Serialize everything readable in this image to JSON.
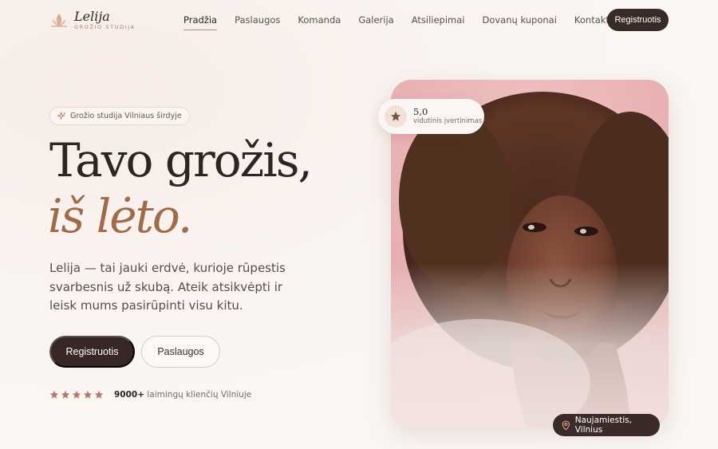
{
  "brand": {
    "name": "Lelija",
    "tagline": "GROŽIO STUDIJA"
  },
  "nav": {
    "items": [
      {
        "label": "Pradžia",
        "active": true
      },
      {
        "label": "Paslaugos",
        "active": false
      },
      {
        "label": "Komanda",
        "active": false
      },
      {
        "label": "Galerija",
        "active": false
      },
      {
        "label": "Atsiliepimai",
        "active": false
      },
      {
        "label": "Dovanų kuponai",
        "active": false
      },
      {
        "label": "Kontaktai",
        "active": false
      }
    ],
    "cta": "Registruotis"
  },
  "hero": {
    "badge": "Grožio studija Vilniaus širdyje",
    "headline_line1": "Tavo grožis,",
    "headline_line2": "iš lėto.",
    "lead": "Lelija — tai jauki erdvė, kurioje rūpestis svarbesnis už skubą. Ateik atsikvėpti ir leisk mums pasirūpinti visu kitu.",
    "primary_button": "Registruotis",
    "secondary_button": "Paslaugos",
    "stars": 5,
    "clients_count": "9000+",
    "clients_text": "laimingų klienčių Vilniuje"
  },
  "rating_card": {
    "score": "5,0",
    "label": "vidutinis įvertinimas"
  },
  "location": {
    "label": "Naujamiestis, Vilnius"
  },
  "colors": {
    "accent": "#a16a48",
    "dark": "#372826",
    "background": "#faf5f2"
  },
  "icons": {
    "badge": "sparkle-icon",
    "rating": "star-icon",
    "location": "map-pin-icon"
  }
}
